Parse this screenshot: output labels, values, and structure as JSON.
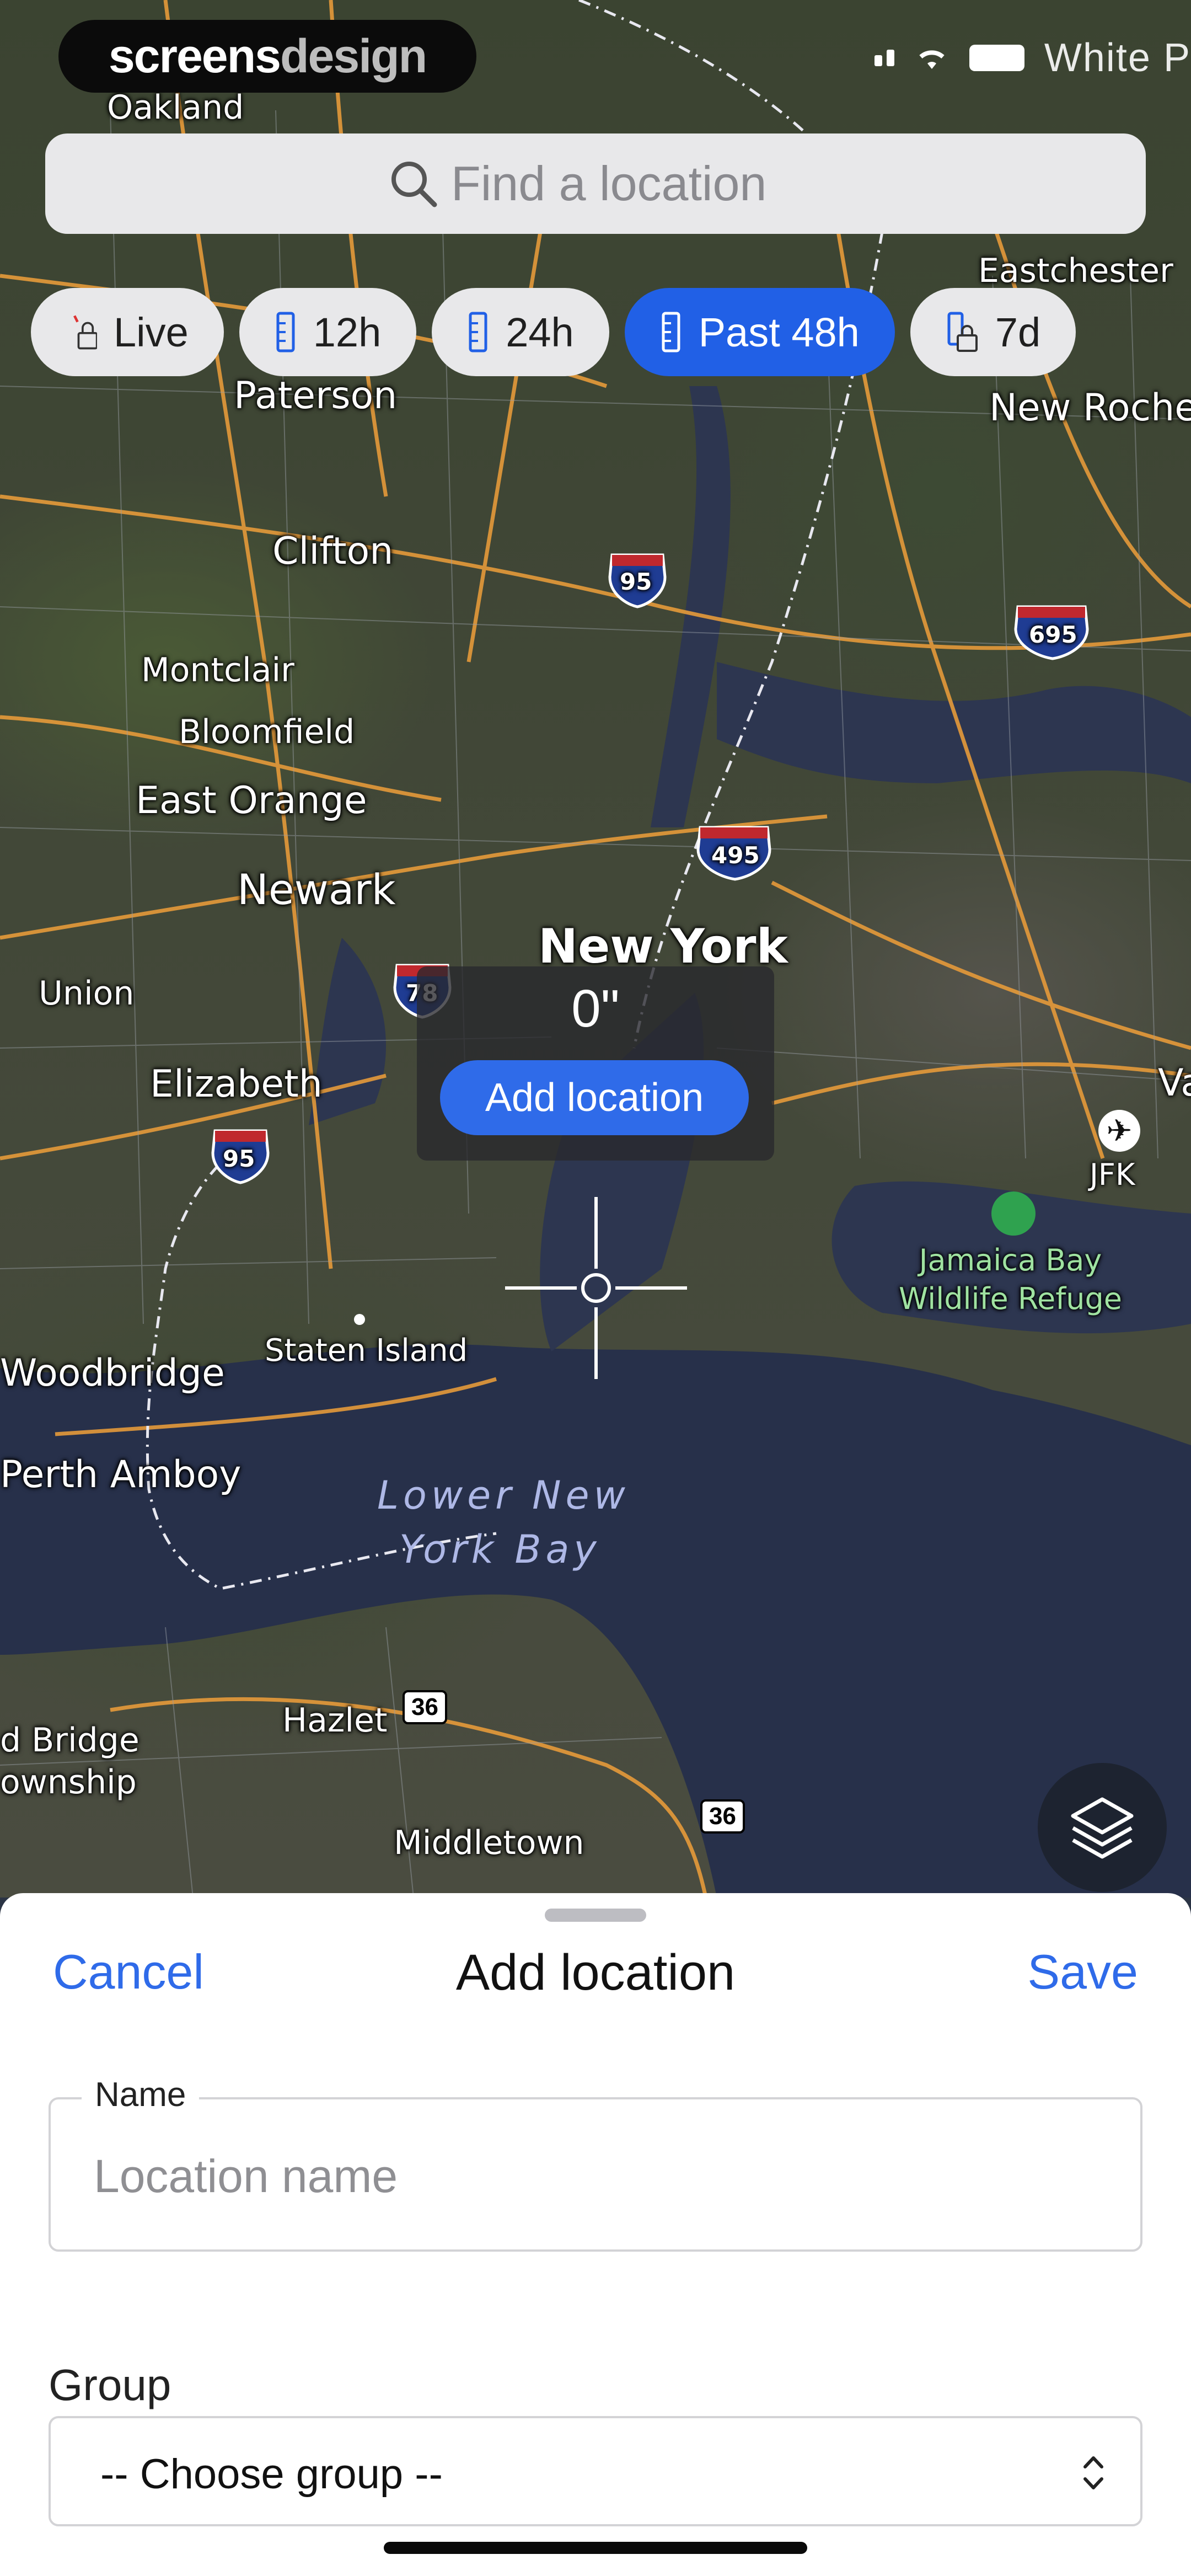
{
  "brand": {
    "part1": "screens",
    "part2": "design"
  },
  "status_bar": {
    "carrier": "White P"
  },
  "search": {
    "placeholder": "Find a location"
  },
  "time_filters": [
    {
      "label": "Live",
      "locked": true,
      "active": false
    },
    {
      "label": "12h",
      "locked": false,
      "active": false
    },
    {
      "label": "24h",
      "locked": false,
      "active": false
    },
    {
      "label": "Past 48h",
      "locked": false,
      "active": true
    },
    {
      "label": "7d",
      "locked": true,
      "active": false
    }
  ],
  "map": {
    "labels": {
      "oakland": "Oakland",
      "eastchester": "Eastchester",
      "paterson": "Paterson",
      "new_rochelle": "New Roche",
      "clifton": "Clifton",
      "montclair": "Montclair",
      "bloomfield": "Bloomfield",
      "east_orange": "East Orange",
      "newark": "Newark",
      "new_york": "New York",
      "union": "Union",
      "elizabeth": "Elizabeth",
      "va": "Va",
      "jfk": "JFK",
      "jamaica_bay": "Jamaica Bay\nWildlife Refuge",
      "staten_island": "Staten Island",
      "woodbridge": "Woodbridge",
      "perth_amboy": "Perth Amboy",
      "lower_ny_bay_1": "Lower New",
      "lower_ny_bay_2": "York Bay",
      "hazlet": "Hazlet",
      "old_bridge_1": "d Bridge",
      "old_bridge_2": "ownship",
      "middletown": "Middletown"
    },
    "shields": {
      "i95_a": "95",
      "i95_b": "95",
      "i695": "695",
      "i495": "495",
      "i78": "78"
    },
    "routes": {
      "r36_a": "36",
      "r36_b": "36"
    }
  },
  "callout": {
    "value": "0\"",
    "button_label": "Add location"
  },
  "sheet": {
    "cancel_label": "Cancel",
    "title": "Add location",
    "save_label": "Save",
    "name_label": "Name",
    "name_placeholder": "Location name",
    "group_label": "Group",
    "group_selected": "-- Choose group --"
  },
  "colors": {
    "accent": "#2f6be9",
    "chip_active": "#2160e6"
  }
}
